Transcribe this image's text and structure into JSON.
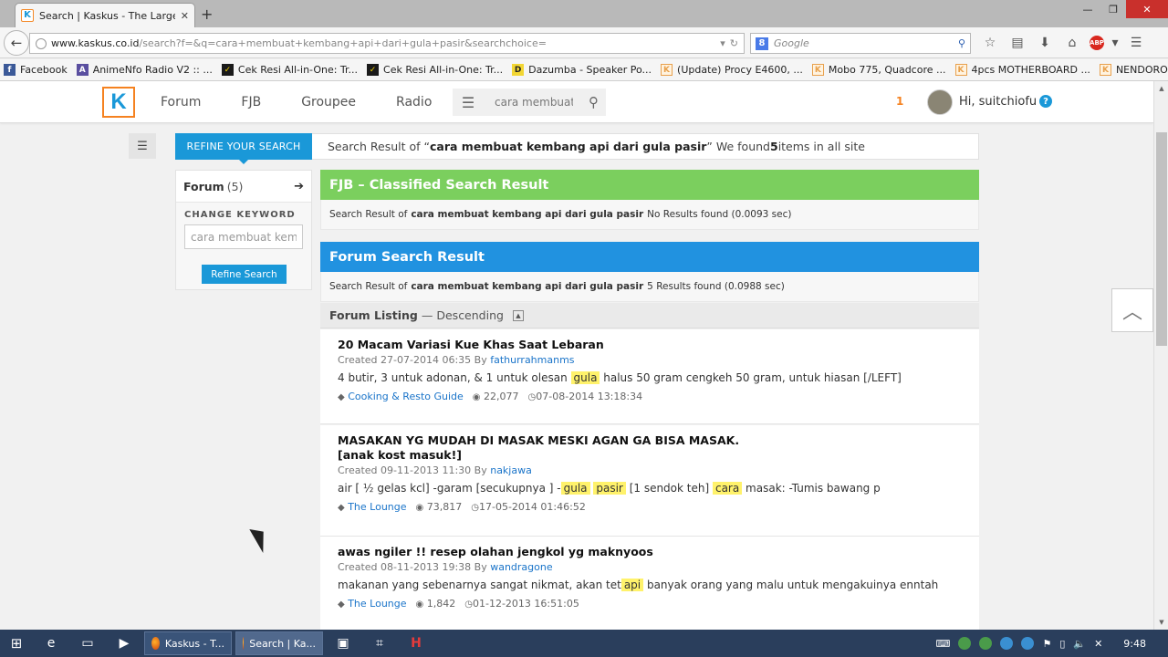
{
  "browser": {
    "tab_title": "Search | Kaskus - The Large...",
    "url_domain": "www.kaskus.co.id",
    "url_path": "/search?f=&q=cara+membuat+kembang+api+dari+gula+pasir&searchchoice=",
    "search_engine_placeholder": "Google",
    "bookmarks": [
      {
        "label": "Facebook",
        "icon": "facebook-icon"
      },
      {
        "label": "AnimeNfo Radio V2 :: ...",
        "icon": "animenfo-icon"
      },
      {
        "label": "Cek Resi All-in-One: Tr...",
        "icon": "cekresi-icon"
      },
      {
        "label": "Cek Resi All-in-One: Tr...",
        "icon": "cekresi-icon"
      },
      {
        "label": "Dazumba - Speaker Po...",
        "icon": "dazumba-icon"
      },
      {
        "label": "(Update) Procy E4600, ...",
        "icon": "kaskus-icon"
      },
      {
        "label": "Mobo 775, Quadcore ...",
        "icon": "kaskus-icon"
      },
      {
        "label": "4pcs MOTHERBOARD ...",
        "icon": "kaskus-icon"
      },
      {
        "label": "NENDOROID (MIKU, A...",
        "icon": "kaskus-icon"
      }
    ]
  },
  "site": {
    "nav": [
      "Forum",
      "FJB",
      "Groupee",
      "Radio"
    ],
    "search_value": "cara membuat k",
    "notification_count": "1",
    "greeting": "Hi, suitchiofu"
  },
  "refine": {
    "tab_label": "REFINE YOUR SEARCH",
    "summary_prefix": "Search Result of “",
    "query": "cara membuat kembang api dari gula pasir",
    "summary_mid": "” We found ",
    "found_count": "5",
    "summary_suffix": " items in all site",
    "forum_label": "Forum",
    "forum_count": "(5)",
    "change_keyword_label": "CHANGE KEYWORD",
    "keyword_value": "cara membuat kemb",
    "refine_button": "Refine Search"
  },
  "fjb": {
    "heading": "FJB – Classified Search Result",
    "line_prefix": "Search Result of",
    "query": "cara membuat kembang api dari gula pasir",
    "line_suffix": "No Results found (0.0093 sec)"
  },
  "forum": {
    "heading": "Forum Search Result",
    "line_prefix": "Search Result of",
    "query": "cara membuat kembang api dari gula pasir",
    "line_suffix": "5 Results found (0.0988 sec)",
    "listing_label": "Forum Listing",
    "listing_sep": "—",
    "listing_order": "Descending"
  },
  "results": [
    {
      "title": "20 Macam Variasi Kue Khas Saat Lebaran",
      "created": "Created 27-07-2014 06:35 By",
      "author": "fathurrahmanms",
      "snippet": [
        {
          "t": "4 butir, 3 untuk adonan, & 1 untuk olesan ",
          "h": false
        },
        {
          "t": "gula",
          "h": true
        },
        {
          "t": " halus 50 gram cengkeh 50 gram, untuk hiasan [/LEFT]",
          "h": false
        }
      ],
      "category": "Cooking & Resto Guide",
      "views": "22,077",
      "last_post": "07-08-2014 13:18:34"
    },
    {
      "title": "MASAKAN YG MUDAH DI MASAK MESKI AGAN GA BISA MASAK.",
      "title2": "[anak kost masuk!]",
      "created": "Created 09-11-2013 11:30 By",
      "author": "nakjawa",
      "snippet": [
        {
          "t": "air [ ½ gelas kcl] -garam [secukupnya ] -",
          "h": false
        },
        {
          "t": "gula",
          "h": true
        },
        {
          "t": " ",
          "h": false
        },
        {
          "t": "pasir",
          "h": true
        },
        {
          "t": " [1 sendok teh] ",
          "h": false
        },
        {
          "t": "cara",
          "h": true
        },
        {
          "t": " masak: -Tumis bawang p",
          "h": false
        }
      ],
      "category": "The Lounge",
      "views": "73,817",
      "last_post": "17-05-2014 01:46:52"
    },
    {
      "title": "awas ngiler !! resep olahan jengkol yg maknyoos",
      "created": "Created 08-11-2013 19:38 By",
      "author": "wandragone",
      "snippet": [
        {
          "t": "makanan yang sebenarnya sangat nikmat, akan tet",
          "h": false
        },
        {
          "t": "api",
          "h": true
        },
        {
          "t": " banyak orang yang malu untuk mengakuinya enntah",
          "h": false
        }
      ],
      "category": "The Lounge",
      "views": "1,842",
      "last_post": "01-12-2013 16:51:05"
    }
  ],
  "taskbar": {
    "apps": [
      "Kaskus - T...",
      "Search | Ka..."
    ],
    "clock": "9:48"
  },
  "colors": {
    "kaskus_blue": "#1a98d8",
    "kaskus_orange": "#f58220",
    "fjb_green": "#7bcf5e",
    "forum_blue": "#2192e0",
    "highlight": "#fff26b"
  }
}
